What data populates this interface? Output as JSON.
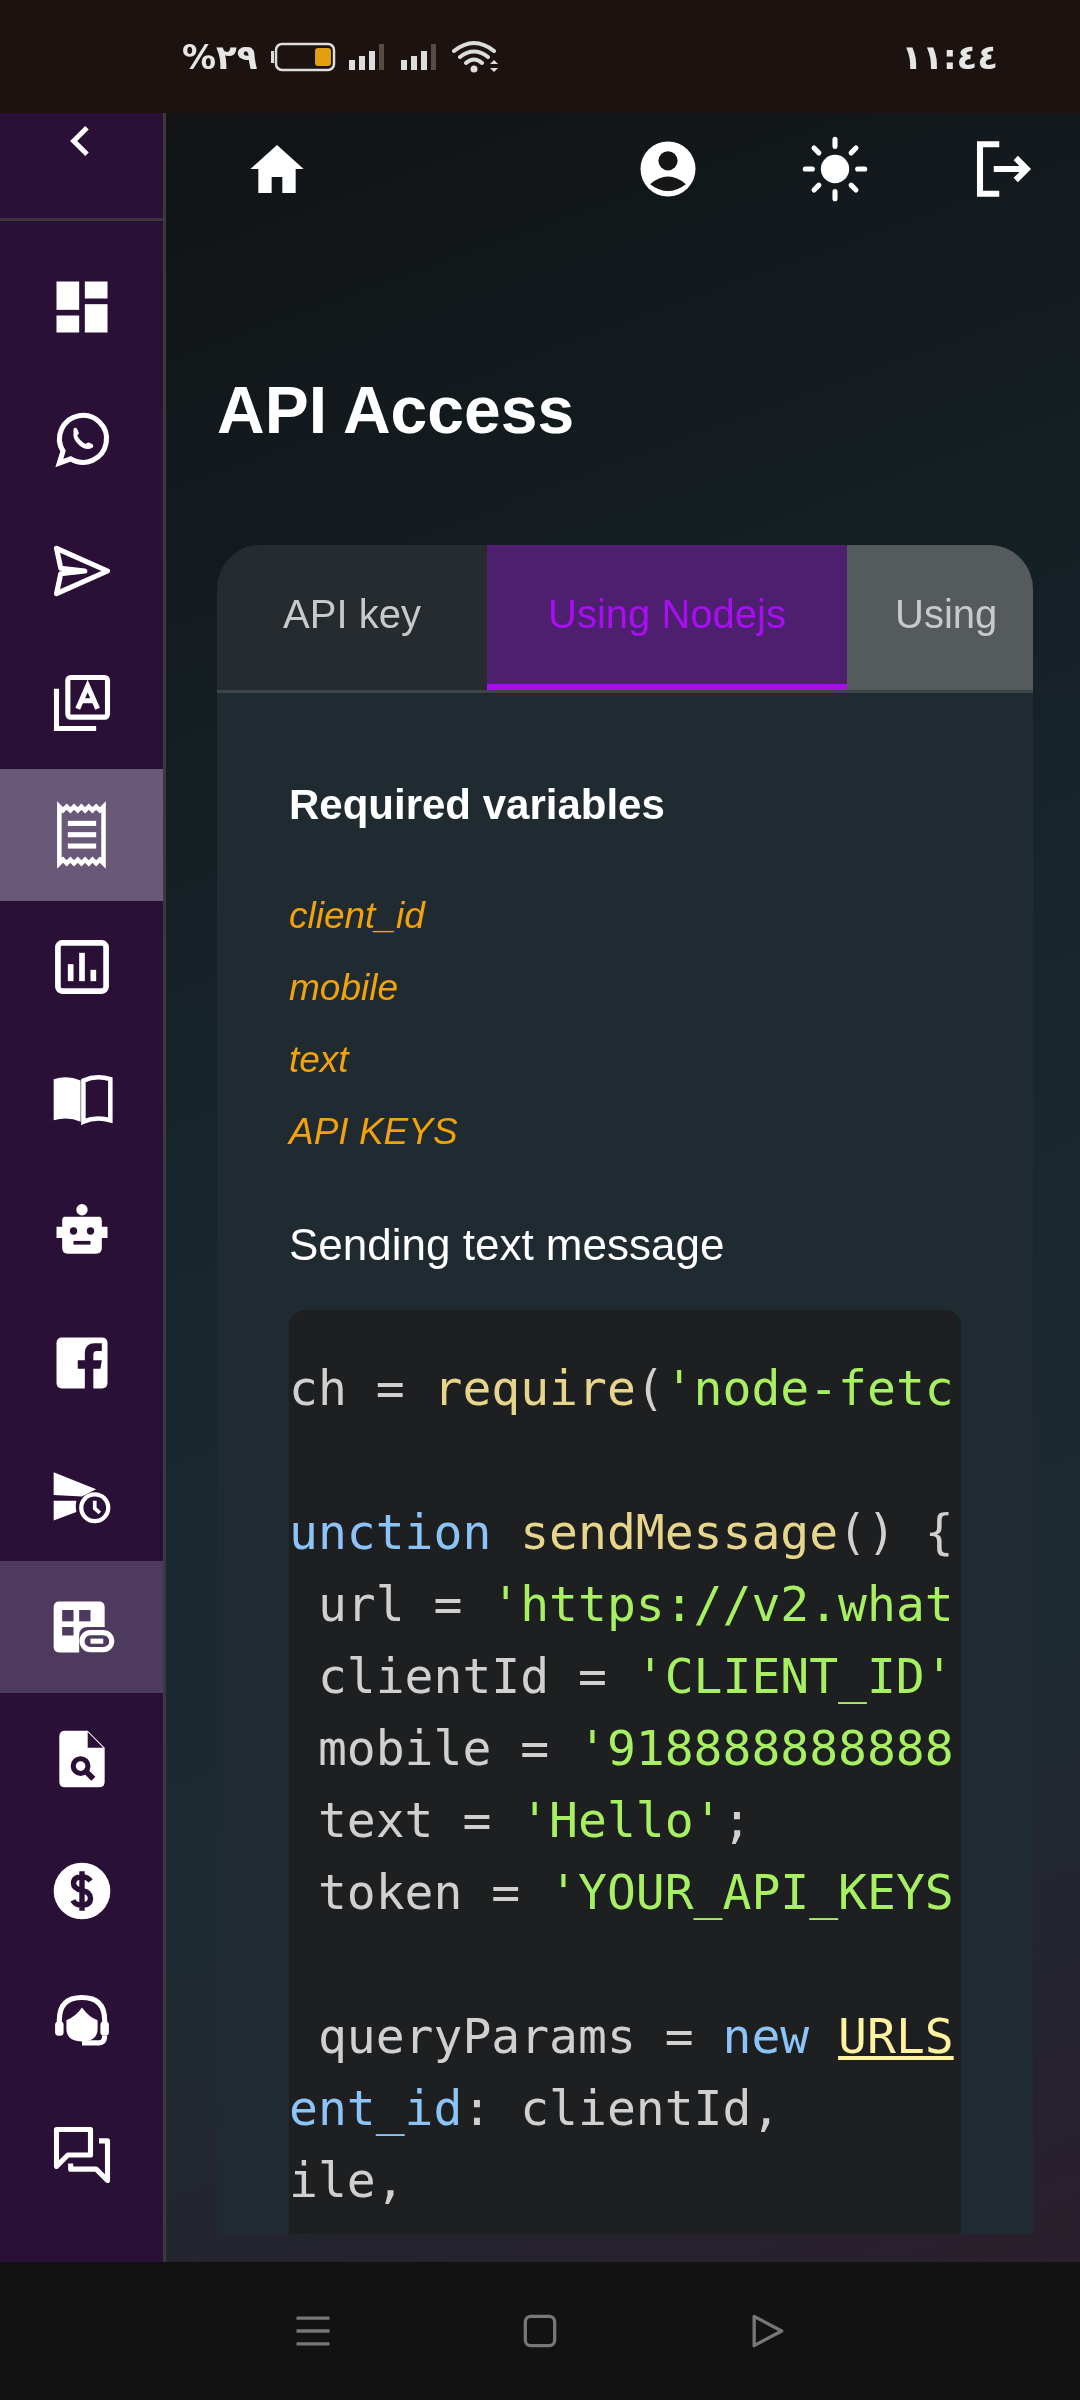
{
  "status_bar": {
    "battery_text": "%٢٩",
    "time": "١١:٤٤"
  },
  "sidebar": {
    "items": [
      {
        "selected": false,
        "focused": false
      },
      {
        "selected": false,
        "focused": false
      },
      {
        "selected": false,
        "focused": false
      },
      {
        "selected": false,
        "focused": false
      },
      {
        "selected": false,
        "focused": true
      },
      {
        "selected": false,
        "focused": false
      },
      {
        "selected": false,
        "focused": false
      },
      {
        "selected": false,
        "focused": false
      },
      {
        "selected": false,
        "focused": false
      },
      {
        "selected": false,
        "focused": false
      },
      {
        "selected": true,
        "focused": false
      },
      {
        "selected": false,
        "focused": false
      },
      {
        "selected": false,
        "focused": false
      },
      {
        "selected": false,
        "focused": false
      },
      {
        "selected": false,
        "focused": false
      }
    ]
  },
  "page": {
    "title": "API Access"
  },
  "tabs": [
    {
      "label": "API key",
      "selected": false
    },
    {
      "label": "Using Nodejs",
      "selected": true
    },
    {
      "label": "Using",
      "selected": false
    }
  ],
  "required": {
    "heading": "Required variables",
    "variables": [
      "client_id",
      "mobile",
      "text",
      "API KEYS"
    ]
  },
  "example": {
    "heading": "Sending text message",
    "blocks": [
      [
        [
          {
            "text": "ch = ",
            "kind": "plain"
          },
          {
            "text": "require",
            "kind": "func"
          },
          {
            "text": "(",
            "kind": "plain"
          },
          {
            "text": "'node-fetc",
            "kind": "string"
          }
        ]
      ],
      [
        [
          {
            "text": "unction",
            "kind": "keyword"
          },
          {
            "text": " sendMessage",
            "kind": "func"
          },
          {
            "text": "() {",
            "kind": "plain"
          }
        ],
        [
          {
            "text": " url = ",
            "kind": "plain"
          },
          {
            "text": "'https://v2.what",
            "kind": "string"
          }
        ],
        [
          {
            "text": " clientId = ",
            "kind": "plain"
          },
          {
            "text": "'CLIENT_ID'",
            "kind": "string"
          }
        ],
        [
          {
            "text": " mobile = ",
            "kind": "plain"
          },
          {
            "text": "'918888888888",
            "kind": "string"
          }
        ],
        [
          {
            "text": " text = ",
            "kind": "plain"
          },
          {
            "text": "'Hello'",
            "kind": "string"
          },
          {
            "text": ";",
            "kind": "plain"
          }
        ],
        [
          {
            "text": " token = ",
            "kind": "plain"
          },
          {
            "text": "'YOUR_API_KEYS",
            "kind": "string"
          }
        ]
      ],
      [
        [
          {
            "text": " queryParams = ",
            "kind": "plain"
          },
          {
            "text": "new ",
            "kind": "keyword"
          },
          {
            "text": "URLS",
            "kind": "class"
          }
        ],
        [
          {
            "text": "ent_id",
            "kind": "keyword"
          },
          {
            "text": ": clientId,",
            "kind": "plain"
          }
        ],
        [
          {
            "text": "ile,",
            "kind": "plain"
          }
        ]
      ]
    ]
  }
}
